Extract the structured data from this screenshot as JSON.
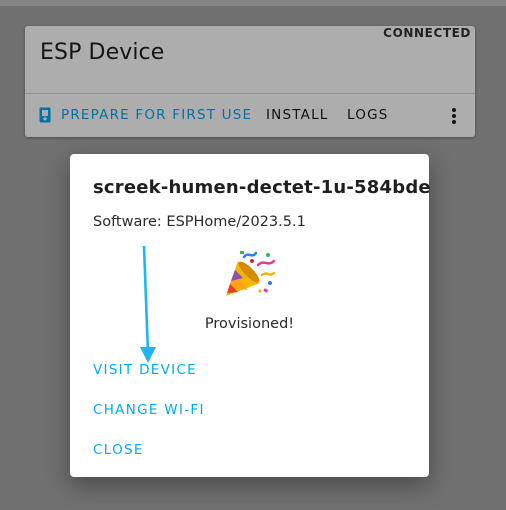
{
  "device_card": {
    "title": "ESP Device",
    "status": "CONNECTED",
    "actions": {
      "prepare": "PREPARE FOR FIRST USE",
      "install": "INSTALL",
      "logs": "LOGS"
    }
  },
  "dialog": {
    "title": "screek-humen-dectet-1u-584bde",
    "software": "Software: ESPHome/2023.5.1",
    "status_text": "Provisioned!",
    "buttons": {
      "visit_device": "VISIT DEVICE",
      "change_wifi": "CHANGE WI-FI",
      "close": "CLOSE"
    }
  },
  "icons": {
    "prepare": "usb-device-icon",
    "menu": "more-vertical-icon",
    "celebration": "party-popper-icon",
    "annotation": "arrow-down-annotation"
  },
  "colors": {
    "accent": "#03a9f4",
    "backdrop": "#a6a6a6"
  }
}
